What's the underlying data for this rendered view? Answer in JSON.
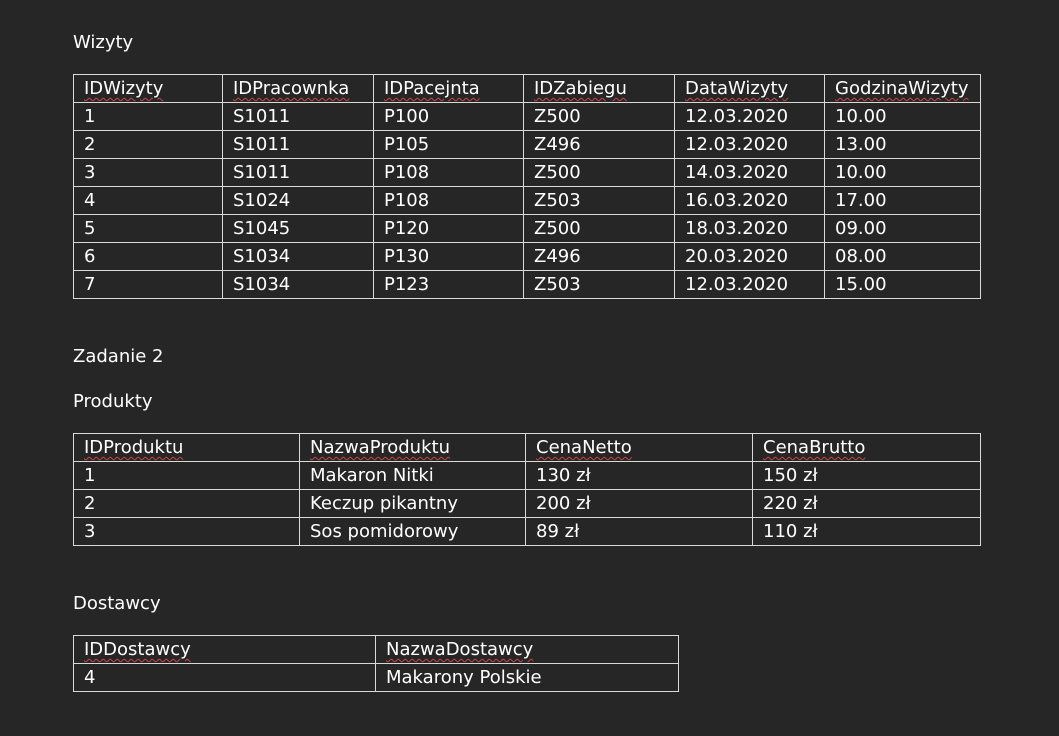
{
  "sections": {
    "wizyty_title": "Wizyty",
    "zadanie_title": "Zadanie 2",
    "produkty_title": "Produkty",
    "dostawcy_title": "Dostawcy"
  },
  "wizyty": {
    "headers": [
      "IDWizyty",
      "IDPracownka",
      "IDPacejnta",
      "IDZabiegu",
      "DataWizyty",
      "GodzinaWizyty"
    ],
    "rows": [
      [
        "1",
        "S1011",
        "P100",
        "Z500",
        "12.03.2020",
        "10.00"
      ],
      [
        "2",
        "S1011",
        "P105",
        "Z496",
        "12.03.2020",
        "13.00"
      ],
      [
        "3",
        "S1011",
        "P108",
        "Z500",
        "14.03.2020",
        "10.00"
      ],
      [
        "4",
        "S1024",
        "P108",
        "Z503",
        "16.03.2020",
        "17.00"
      ],
      [
        "5",
        "S1045",
        "P120",
        "Z500",
        "18.03.2020",
        "09.00"
      ],
      [
        "6",
        "S1034",
        "P130",
        "Z496",
        "20.03.2020",
        "08.00"
      ],
      [
        "7",
        "S1034",
        "P123",
        "Z503",
        "12.03.2020",
        "15.00"
      ]
    ]
  },
  "produkty": {
    "headers": [
      "IDProduktu",
      "NazwaProduktu",
      "CenaNetto",
      "CenaBrutto"
    ],
    "rows": [
      [
        "1",
        "Makaron Nitki",
        "130 zł",
        "150 zł"
      ],
      [
        "2",
        "Keczup pikantny",
        "200 zł",
        "220 zł"
      ],
      [
        "3",
        "Sos pomidorowy",
        "89 zł",
        "110 zł"
      ]
    ]
  },
  "dostawcy": {
    "headers": [
      "IDDostawcy",
      "NazwaDostawcy"
    ],
    "rows": [
      [
        "4",
        "Makarony Polskie"
      ]
    ]
  }
}
